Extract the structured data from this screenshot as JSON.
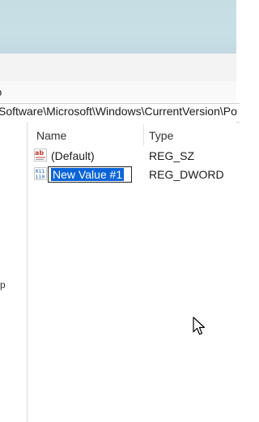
{
  "menu": {
    "partial_label": "p"
  },
  "address": {
    "path": "Software\\Microsoft\\Windows\\CurrentVersion\\Po"
  },
  "tree": {
    "partial_glyph": "p"
  },
  "columns": {
    "name": "Name",
    "type": "Type"
  },
  "rows": [
    {
      "name": "(Default)",
      "type": "REG_SZ",
      "icon": "string-value-icon"
    },
    {
      "name": "New Value #1",
      "type": "REG_DWORD",
      "icon": "binary-value-icon",
      "editing": true
    }
  ],
  "colors": {
    "selection": "#0a64d8",
    "titlebar": "#c6dde4",
    "string_icon": "#c0392b",
    "binary_icon": "#1f5fbf"
  }
}
